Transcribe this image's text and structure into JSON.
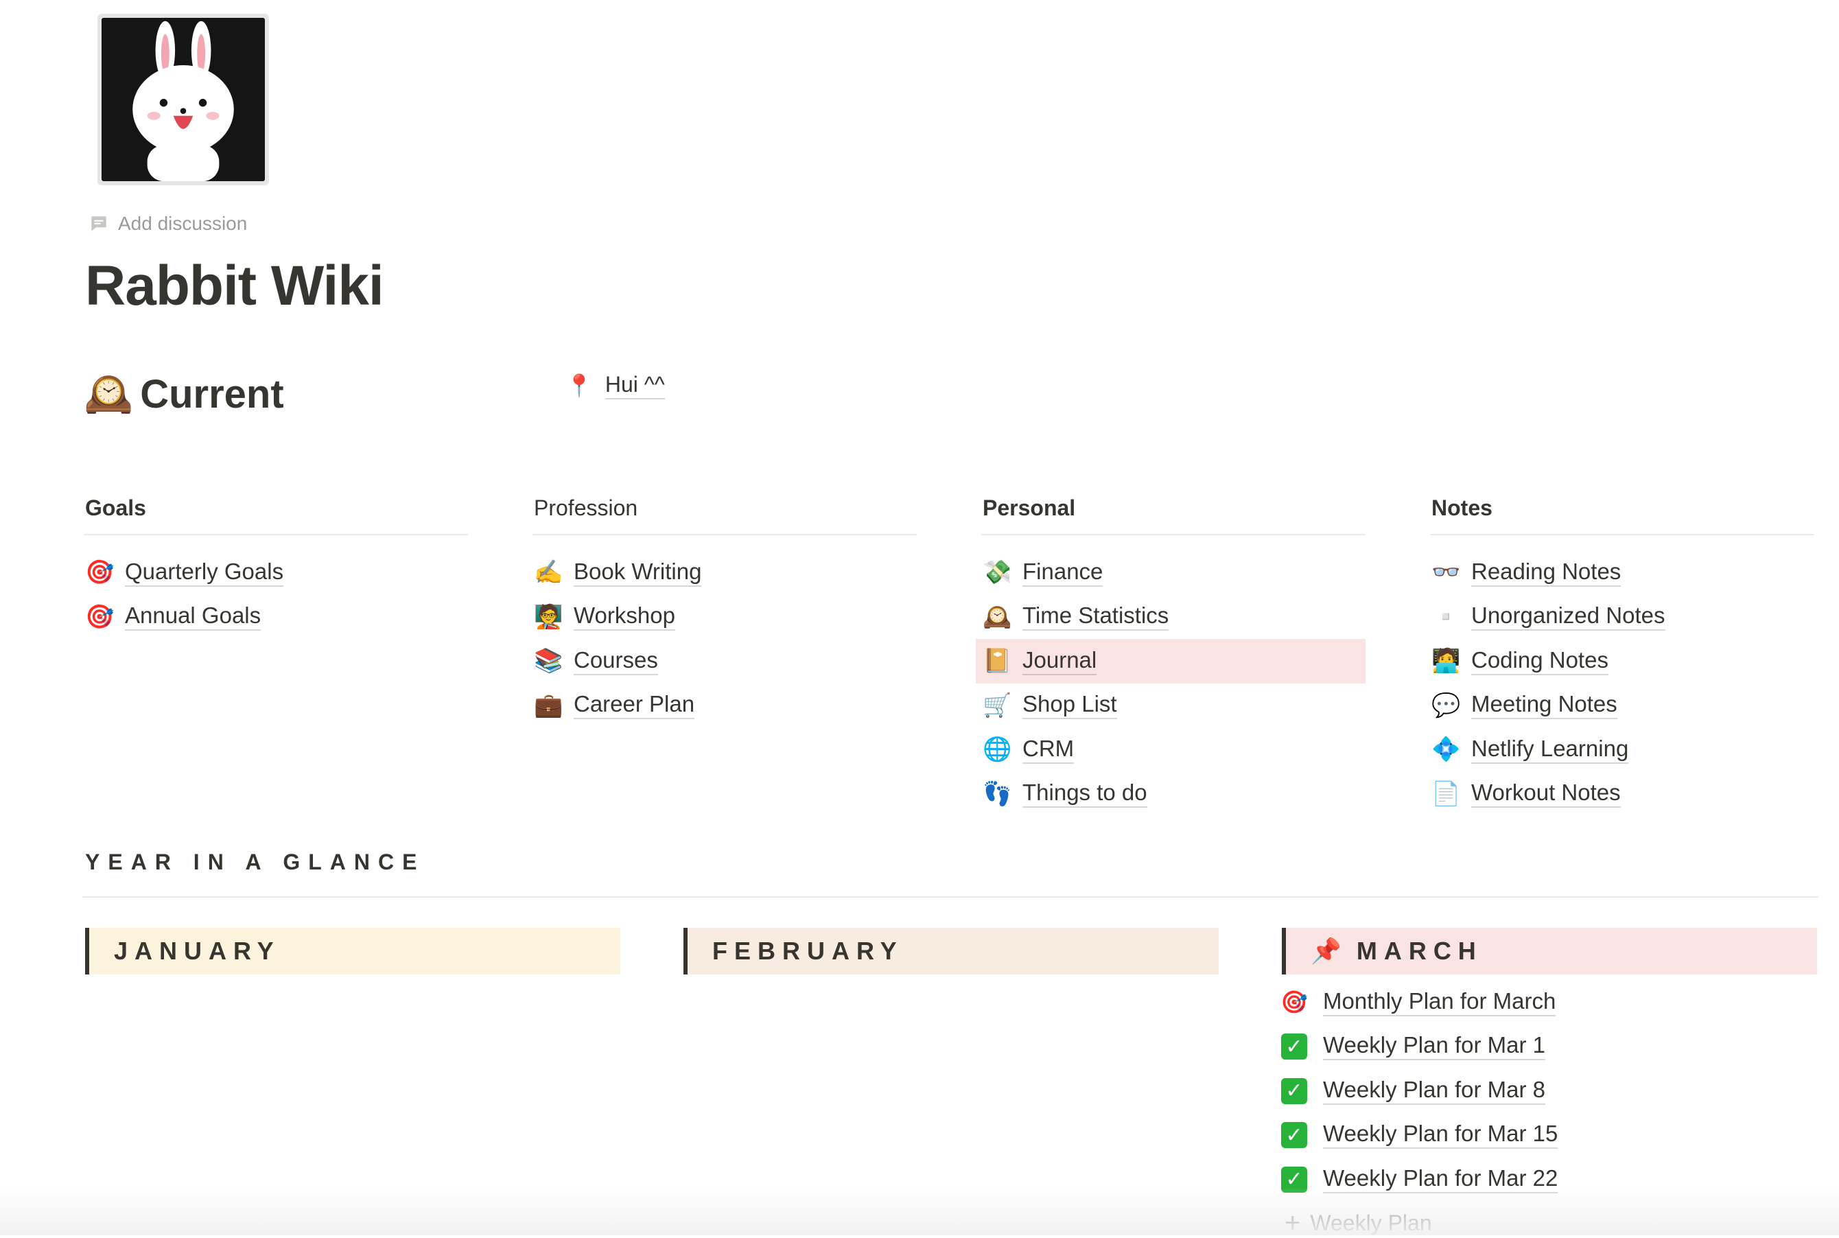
{
  "page": {
    "icon": "rabbit-avatar-icon",
    "add_discussion": "Add discussion",
    "title": "Rabbit Wiki"
  },
  "current": {
    "icon": "mantelpiece-clock-icon",
    "heading": "Current",
    "pin_icon": "round-pushpin-icon",
    "pin_label": "Hui ^^"
  },
  "columns": [
    {
      "heading": "Goals",
      "items": [
        {
          "icon": "direct-hit-icon",
          "emoji": "🎯",
          "label": "Quarterly Goals"
        },
        {
          "icon": "direct-hit-icon",
          "emoji": "🎯",
          "label": "Annual Goals"
        }
      ]
    },
    {
      "heading": "Profession",
      "items": [
        {
          "icon": "writing-hand-icon",
          "emoji": "✍️",
          "label": "Book Writing"
        },
        {
          "icon": "teacher-icon",
          "emoji": "🧑‍🏫",
          "label": "Workshop"
        },
        {
          "icon": "books-icon",
          "emoji": "📚",
          "label": "Courses"
        },
        {
          "icon": "briefcase-icon",
          "emoji": "💼",
          "label": "Career Plan"
        }
      ]
    },
    {
      "heading": "Personal",
      "items": [
        {
          "icon": "money-with-wings-icon",
          "emoji": "💸",
          "label": "Finance"
        },
        {
          "icon": "mantelpiece-clock-icon",
          "emoji": "🕰️",
          "label": "Time Statistics"
        },
        {
          "icon": "notebook-icon",
          "emoji": "📔",
          "label": "Journal",
          "highlight": true
        },
        {
          "icon": "shopping-cart-icon",
          "emoji": "🛒",
          "label": "Shop List"
        },
        {
          "icon": "globe-icon",
          "emoji": "🌐",
          "label": "CRM"
        },
        {
          "icon": "footprints-icon",
          "emoji": "👣",
          "label": "Things to do"
        }
      ]
    },
    {
      "heading": "Notes",
      "items": [
        {
          "icon": "glasses-icon",
          "emoji": "👓",
          "label": "Reading Notes"
        },
        {
          "icon": "blank-page-icon",
          "emoji": "▫️",
          "label": "Unorganized Notes"
        },
        {
          "icon": "technologist-icon",
          "emoji": "🧑‍💻",
          "label": "Coding Notes"
        },
        {
          "icon": "speech-bubble-icon",
          "emoji": "💬",
          "label": "Meeting Notes"
        },
        {
          "icon": "netlify-diamond-icon",
          "emoji": "💠",
          "label": "Netlify Learning"
        },
        {
          "icon": "document-icon",
          "emoji": "📄",
          "label": "Workout Notes"
        }
      ]
    }
  ],
  "glance": {
    "heading": "YEAR IN A GLANCE"
  },
  "months": [
    {
      "label": "JANUARY",
      "color": "#fbf3db"
    },
    {
      "label": "FEBRUARY",
      "color": "#f8ebe0"
    },
    {
      "label": "MARCH",
      "color": "#f9e4e3",
      "icon": "pushpin-icon",
      "emoji": "📌"
    }
  ],
  "march_items": [
    {
      "icon": "direct-hit-icon",
      "emoji": "🎯",
      "label": "Monthly Plan for March"
    },
    {
      "icon": "check-mark-button-icon",
      "label": "Weekly Plan for Mar 1"
    },
    {
      "icon": "check-mark-button-icon",
      "label": "Weekly Plan for Mar 8"
    },
    {
      "icon": "check-mark-button-icon",
      "label": "Weekly Plan for Mar 15"
    },
    {
      "icon": "check-mark-button-icon",
      "label": "Weekly Plan for Mar 22"
    }
  ],
  "add_weekly": "Weekly Plan",
  "colors": {
    "text": "#37352f",
    "muted": "#9b9a97",
    "highlight": "#f9e4e3",
    "check": "#27b23a"
  }
}
